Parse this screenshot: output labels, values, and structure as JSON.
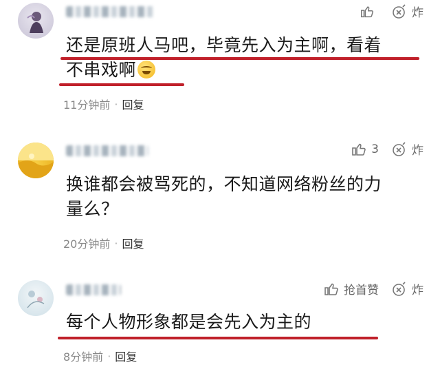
{
  "comments": [
    {
      "username": "",
      "text_lines": [
        "还是原班人马吧，毕竟先入为主啊，看着",
        "不串戏啊"
      ],
      "has_emoji": true,
      "like_label": "",
      "blast_label": "炸",
      "time": "11分钟前",
      "reply_label": "回复"
    },
    {
      "username": "",
      "text_lines": [
        "换谁都会被骂死的，不知道网络粉丝的力",
        "量么？"
      ],
      "has_emoji": false,
      "like_label": "3",
      "blast_label": "炸",
      "time": "20分钟前",
      "reply_label": "回复"
    },
    {
      "username": "",
      "text_lines": [
        "每个人物形象都是会先入为主的"
      ],
      "has_emoji": false,
      "like_label": "抢首赞",
      "blast_label": "炸",
      "time": "8分钟前",
      "reply_label": "回复"
    }
  ],
  "separator": "·",
  "colors": {
    "underline": "#c0202a",
    "meta_text": "#888888",
    "body_text": "#1a1a1a"
  },
  "icons": {
    "like": "thumbs-up-icon",
    "blast": "blast-icon"
  }
}
